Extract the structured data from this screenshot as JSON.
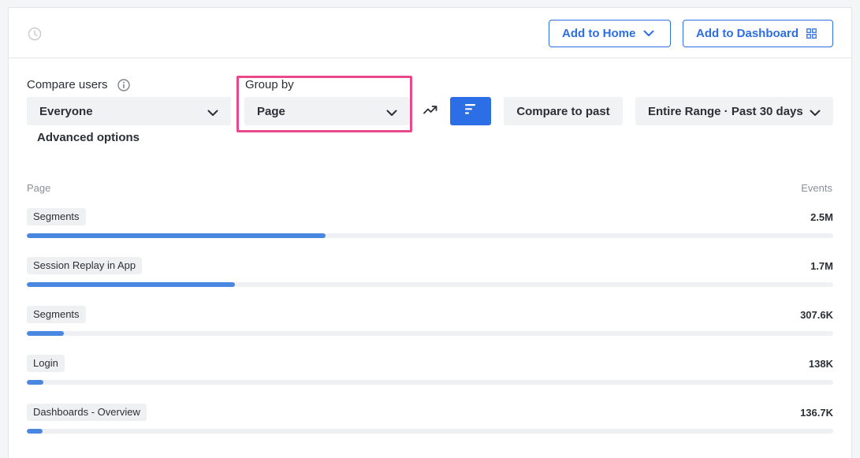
{
  "header": {
    "add_home_label": "Add to Home",
    "add_dashboard_label": "Add to Dashboard"
  },
  "filters": {
    "compare_users_label": "Compare users",
    "compare_users_value": "Everyone",
    "group_by_label": "Group by",
    "group_by_value": "Page",
    "compare_past_label": "Compare to past",
    "range_value": "Entire Range · Past 30 days",
    "advanced_label": "Advanced options"
  },
  "table": {
    "col_page": "Page",
    "col_events": "Events",
    "rows": [
      {
        "label": "Segments",
        "value": "2.5M",
        "fraction": 0.37
      },
      {
        "label": "Session Replay in App",
        "value": "1.7M",
        "fraction": 0.258
      },
      {
        "label": "Segments",
        "value": "307.6K",
        "fraction": 0.046
      },
      {
        "label": "Login",
        "value": "138K",
        "fraction": 0.021
      },
      {
        "label": "Dashboards - Overview",
        "value": "136.7K",
        "fraction": 0.02
      }
    ]
  },
  "colors": {
    "accent": "#2c6ee6",
    "bar_fill": "#4a87e0",
    "highlight": "#e8498a"
  },
  "icons": {
    "clock": "clock-icon",
    "chevron": "chevron-down-icon",
    "grid": "grid-icon",
    "info": "info-icon",
    "trend": "trend-line-icon",
    "bars": "bar-chart-icon"
  }
}
